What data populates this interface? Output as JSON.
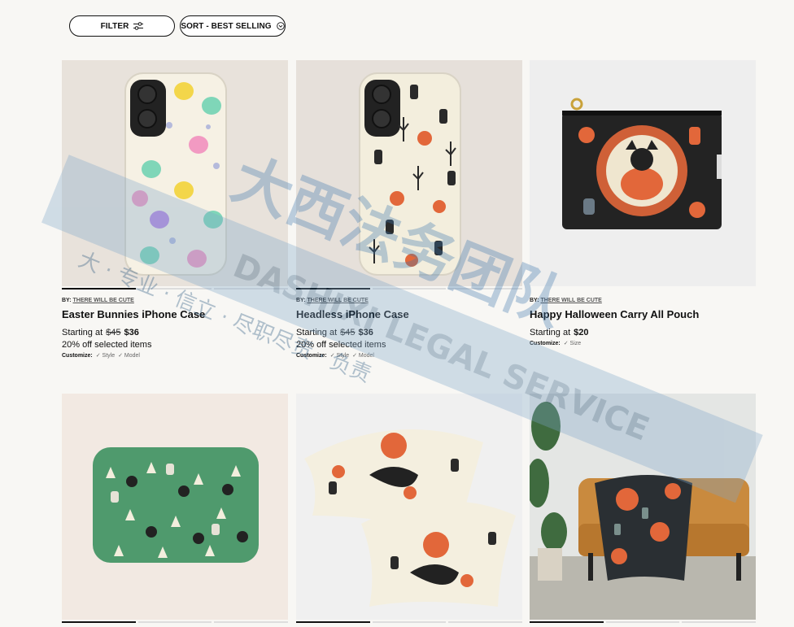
{
  "toolbar": {
    "filter_label": "FILTER",
    "sort_label": "SORT - BEST SELLING"
  },
  "products": [
    {
      "by_prefix": "BY:",
      "artist": "THERE WILL BE CUTE",
      "title": "Easter Bunnies iPhone Case",
      "price_prefix": "Starting at",
      "old_price": "$45",
      "new_price": "$36",
      "promo": "20% off selected items",
      "customize_label": "Customize:",
      "options": [
        "✓ Style",
        "✓ Model"
      ]
    },
    {
      "by_prefix": "BY:",
      "artist": "THERE WILL BE CUTE",
      "title": "Headless iPhone Case",
      "price_prefix": "Starting at",
      "old_price": "$45",
      "new_price": "$36",
      "promo": "20% off selected items",
      "customize_label": "Customize:",
      "options": [
        "✓ Style",
        "✓ Model"
      ]
    },
    {
      "by_prefix": "BY:",
      "artist": "THERE WILL BE CUTE",
      "title": "Happy Halloween Carry All Pouch",
      "price_prefix": "Starting at",
      "new_price": "$20",
      "customize_label": "Customize:",
      "options": [
        "✓ Size"
      ]
    }
  ],
  "watermark": {
    "text_cn_large": "大西法务团队",
    "text_en": "DASHIXI LEGAL SERVICE",
    "text_cn_small": "大 · 专业 · 信立 · 尽职尽责 · 负责"
  },
  "colors": {
    "accent": "#111111",
    "thumb_bg_1": "#e8e2db",
    "thumb_bg_2": "#e6e0da",
    "thumb_bg_3": "#eeeeee",
    "thumb_bg_4": "#f2e9e2",
    "thumb_bg_5": "#f0f0f0",
    "halloween_orange": "#e2673a",
    "green": "#4f9a6d"
  }
}
